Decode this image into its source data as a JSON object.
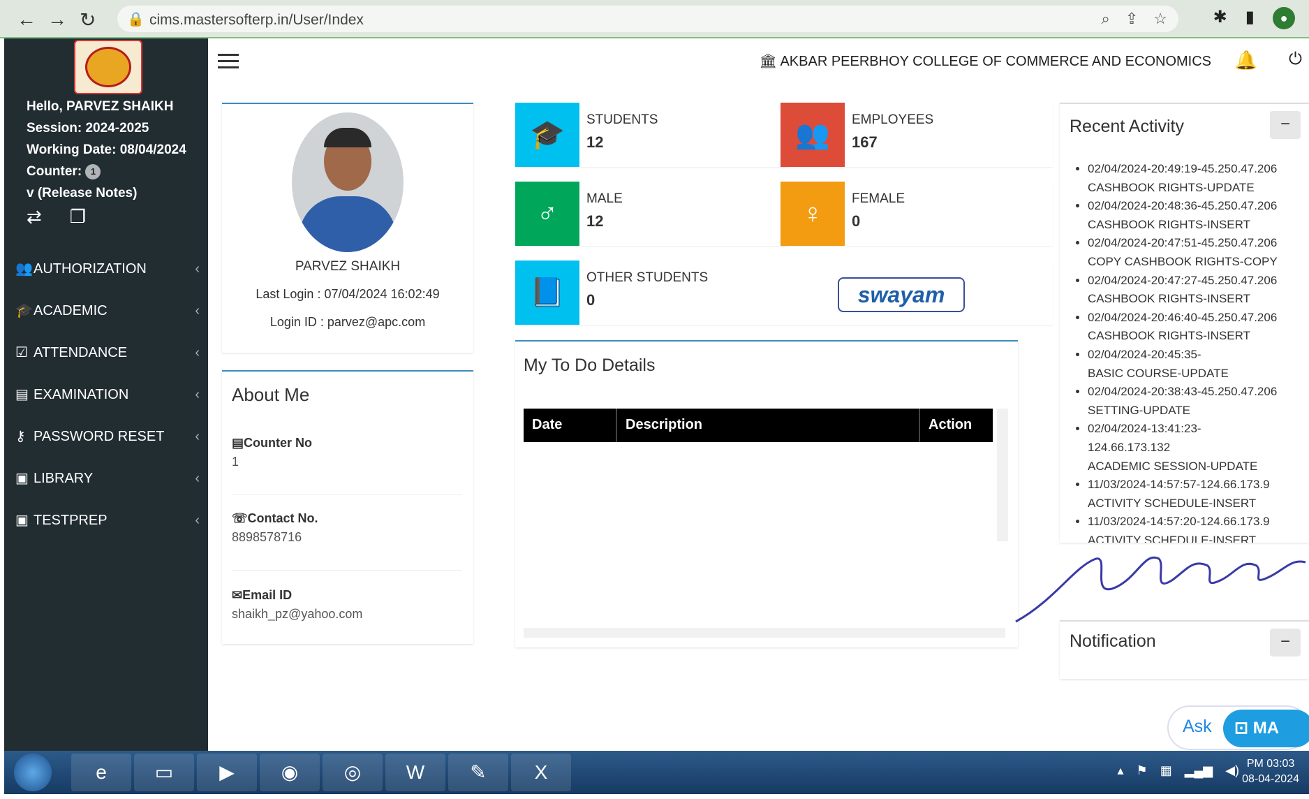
{
  "browser": {
    "url": "cims.mastersofterp.in/User/Index"
  },
  "sidebar": {
    "greeting": "Hello, PARVEZ SHAIKH",
    "session": "Session: 2024-2025",
    "working_date": "Working Date: 08/04/2024",
    "counter_label": "Counter:",
    "counter_value": "1",
    "release_notes": "v (Release Notes)",
    "items": [
      {
        "label": "AUTHORIZATION",
        "icon": "users-icon"
      },
      {
        "label": "ACADEMIC",
        "icon": "graduation-cap-icon"
      },
      {
        "label": "ATTENDANCE",
        "icon": "check-square-icon"
      },
      {
        "label": "EXAMINATION",
        "icon": "book-icon"
      },
      {
        "label": "PASSWORD RESET",
        "icon": "key-icon"
      },
      {
        "label": "LIBRARY",
        "icon": "library-icon"
      },
      {
        "label": "TESTPREP",
        "icon": "testprep-icon"
      }
    ]
  },
  "header": {
    "college": "AKBAR PEERBHOY COLLEGE OF COMMERCE AND ECONOMICS"
  },
  "profile": {
    "name": "PARVEZ SHAIKH",
    "last_login": "Last Login : 07/04/2024 16:02:49",
    "login_id": "Login ID : parvez@apc.com"
  },
  "about": {
    "title": "About Me",
    "counter_label": "Counter No",
    "counter_value": "1",
    "contact_label": "Contact No.",
    "contact_value": "8898578716",
    "email_label": "Email ID",
    "email_value": "shaikh_pz@yahoo.com"
  },
  "stats": {
    "students_label": "STUDENTS",
    "students_value": "12",
    "employees_label": "EMPLOYEES",
    "employees_value": "167",
    "male_label": "MALE",
    "male_value": "12",
    "female_label": "FEMALE",
    "female_value": "0",
    "other_label": "OTHER STUDENTS",
    "other_value": "0",
    "swayam": "swayam"
  },
  "todo": {
    "title": "My To Do Details",
    "col_date": "Date",
    "col_description": "Description",
    "col_action": "Action"
  },
  "recent": {
    "title": "Recent Activity",
    "collapse": "−",
    "items": [
      {
        "line1": "02/04/2024-20:49:19-45.250.47.206",
        "line2": "CASHBOOK RIGHTS-UPDATE"
      },
      {
        "line1": "02/04/2024-20:48:36-45.250.47.206",
        "line2": "CASHBOOK RIGHTS-INSERT"
      },
      {
        "line1": "02/04/2024-20:47:51-45.250.47.206",
        "line2": "COPY CASHBOOK RIGHTS-COPY"
      },
      {
        "line1": "02/04/2024-20:47:27-45.250.47.206",
        "line2": "CASHBOOK RIGHTS-INSERT"
      },
      {
        "line1": "02/04/2024-20:46:40-45.250.47.206",
        "line2": "CASHBOOK RIGHTS-INSERT"
      },
      {
        "line1": "02/04/2024-20:45:35-",
        "line2": "BASIC COURSE-UPDATE"
      },
      {
        "line1": "02/04/2024-20:38:43-45.250.47.206",
        "line2": "SETTING-UPDATE"
      },
      {
        "line1": "02/04/2024-13:41:23-",
        "line2": "124.66.173.132"
      },
      {
        "line1": "ACADEMIC SESSION-UPDATE",
        "line2": ""
      },
      {
        "line1": "11/03/2024-14:57:57-124.66.173.9",
        "line2": "ACTIVITY SCHEDULE-INSERT"
      },
      {
        "line1": "11/03/2024-14:57:20-124.66.173.9",
        "line2": "ACTIVITY SCHEDULE-INSERT"
      }
    ]
  },
  "notification": {
    "title": "Notification",
    "collapse": "−"
  },
  "ask": {
    "ask_label": "Ask",
    "brand": "MA"
  },
  "taskbar": {
    "time": "PM 03:03",
    "date": "08-04-2024"
  },
  "colors": {
    "sidebar_bg": "#222d32",
    "students": "#00c0ef",
    "employees": "#dd4b39",
    "male": "#00a65a",
    "female": "#f39c12",
    "other": "#00c0ef"
  }
}
